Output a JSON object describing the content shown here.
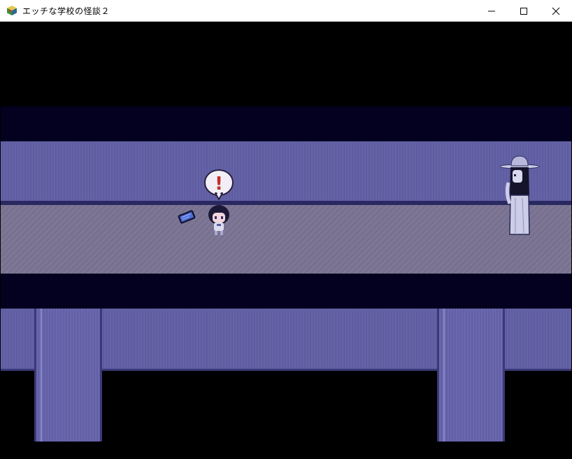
{
  "window": {
    "title": "エッチな学校の怪談２",
    "icon": "game-app-icon",
    "controls": [
      "minimize-icon",
      "maximize-icon",
      "close-icon"
    ]
  },
  "scene": {
    "balloon_symbol": "!",
    "characters": [
      "player-girl",
      "ghost-woman-with-hat"
    ],
    "items": [
      "smartphone"
    ]
  },
  "colors": {
    "dark_band": "#03011f",
    "wall": "#6563a8",
    "floor": "#7e7896",
    "balloon_mark": "#c0302a"
  }
}
